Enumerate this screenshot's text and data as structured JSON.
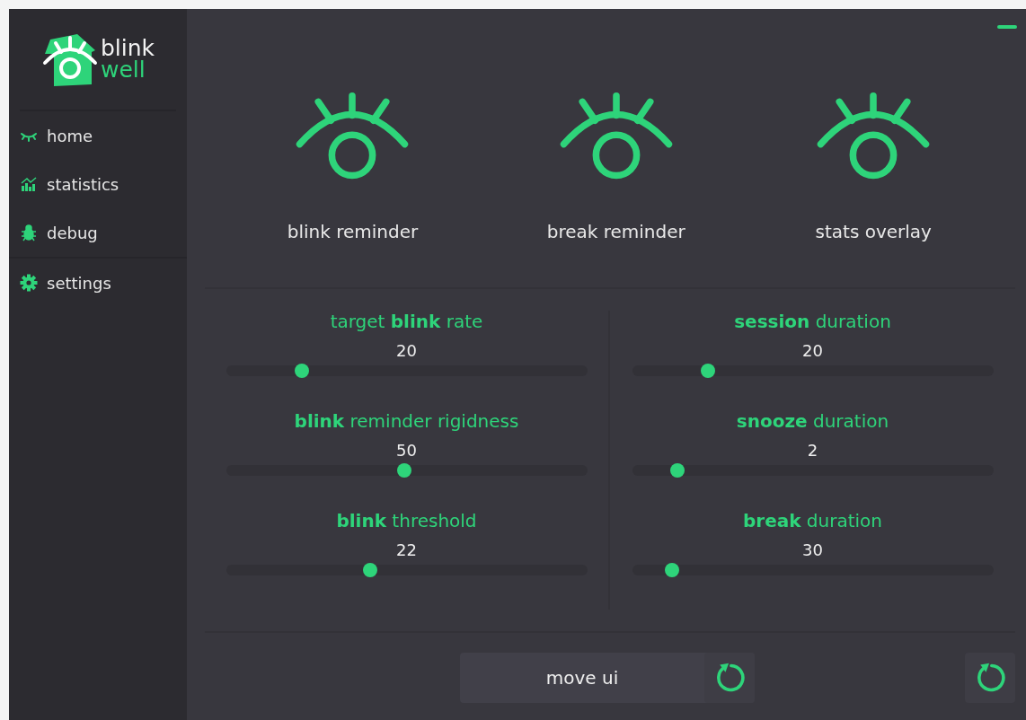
{
  "logo": {
    "line_1": "blink",
    "line_2": "well"
  },
  "sidebar": {
    "items": [
      {
        "label": "home",
        "kind": "eye"
      },
      {
        "label": "statistics",
        "kind": "chart"
      },
      {
        "label": "debug",
        "kind": "bug"
      },
      {
        "label": "settings",
        "kind": "gear"
      }
    ]
  },
  "features": [
    {
      "label": "blink reminder"
    },
    {
      "label": "break reminder"
    },
    {
      "label": "stats overlay"
    }
  ],
  "sliders": [
    {
      "label": "target **blink** rate",
      "value": "20",
      "level": 0.21
    },
    {
      "label": "**session** duration",
      "value": "20",
      "level": 0.21
    },
    {
      "label": "**blink** reminder rigidness",
      "value": "50",
      "level": 0.495
    },
    {
      "label": "**snooze** duration",
      "value": "2",
      "level": 0.125
    },
    {
      "label": "**blink** threshold",
      "value": "22",
      "level": 0.4
    },
    {
      "label": "**break** duration",
      "value": "30",
      "level": 0.11
    }
  ],
  "buttons": [
    {
      "label": "move ui"
    }
  ]
}
